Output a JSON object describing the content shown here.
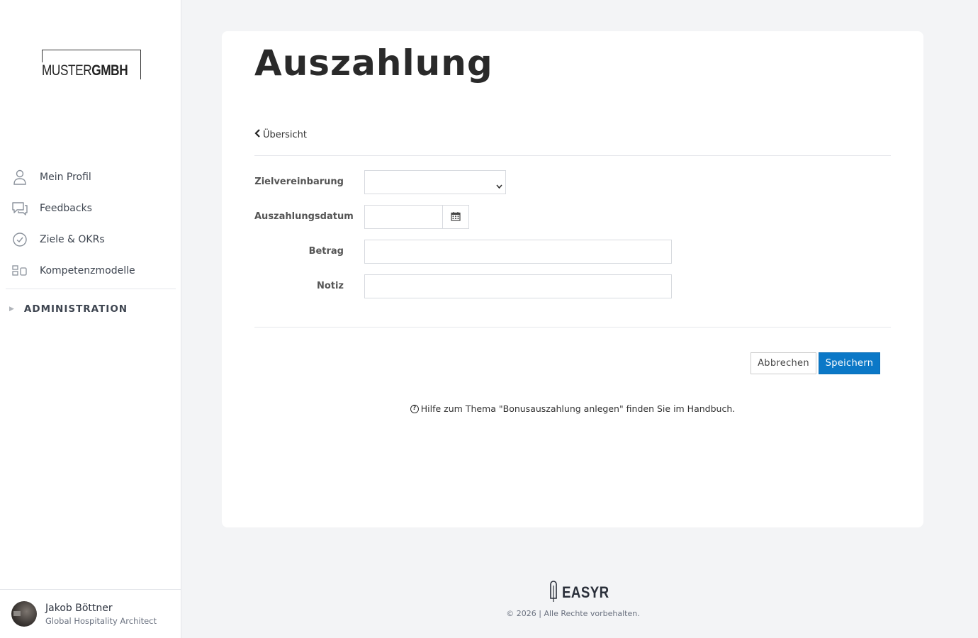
{
  "logo": {
    "light": "MUSTER",
    "bold": "GMBH"
  },
  "nav": {
    "items": [
      {
        "label": "Mein Profil",
        "icon": "user-icon"
      },
      {
        "label": "Feedbacks",
        "icon": "chat-bubbles-icon"
      },
      {
        "label": "Ziele & OKRs",
        "icon": "check-circle-icon"
      },
      {
        "label": "Kompetenzmodelle",
        "icon": "model-blocks-icon"
      }
    ],
    "admin_label": "ADMINISTRATION"
  },
  "user": {
    "name": "Jakob Böttner",
    "role": "Global Hospitality Architect"
  },
  "page": {
    "title": "Auszahlung",
    "back_label": "Übersicht"
  },
  "form": {
    "zielvereinbarung_label": "Zielvereinbarung",
    "zielvereinbarung_value": "",
    "datum_label": "Auszahlungsdatum",
    "datum_value": "",
    "betrag_label": "Betrag",
    "betrag_value": "",
    "notiz_label": "Notiz",
    "notiz_value": ""
  },
  "actions": {
    "cancel_label": "Abbrechen",
    "save_label": "Speichern"
  },
  "help": {
    "text": "Hilfe zum Thema \"Bonusauszahlung anlegen\" finden Sie im Handbuch."
  },
  "footer": {
    "brand": "EASYR",
    "copyright": "© 2026 | Alle Rechte vorbehalten."
  },
  "colors": {
    "primary": "#0b78c7",
    "background": "#f3f4f6"
  }
}
